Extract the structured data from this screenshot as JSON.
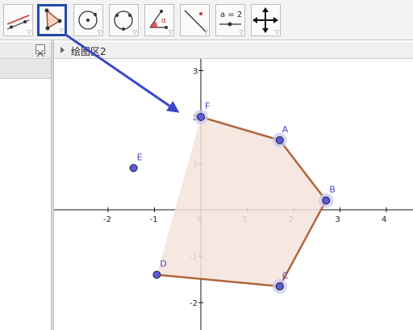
{
  "toolbar": {
    "tools": [
      {
        "name": "line-tool"
      },
      {
        "name": "polygon-tool",
        "selected": true
      },
      {
        "name": "circle-center-point-tool"
      },
      {
        "name": "circle-three-points-tool"
      },
      {
        "name": "angle-tool",
        "glyph": "α"
      },
      {
        "name": "perpendicular-tool"
      },
      {
        "name": "slider-tool",
        "label": "a = 2"
      },
      {
        "name": "move-view-tool"
      }
    ]
  },
  "graphics_view": {
    "title": "绘图区2",
    "x_ticks": [
      "-2",
      "-1",
      "0",
      "1",
      "2",
      "3",
      "4"
    ],
    "y_ticks": [
      "3",
      "2",
      "1",
      "-1",
      "-2"
    ]
  },
  "points": [
    {
      "label": "F",
      "x": 0,
      "y": 2
    },
    {
      "label": "A",
      "x": 1.7,
      "y": 1.5
    },
    {
      "label": "B",
      "x": 2.7,
      "y": 0.2
    },
    {
      "label": "C",
      "x": 1.7,
      "y": -1.65
    },
    {
      "label": "D",
      "x": -0.95,
      "y": -1.4
    },
    {
      "label": "E",
      "x": -1.45,
      "y": 0.9
    }
  ],
  "colors": {
    "polygon_stroke": "#b0663d",
    "polygon_fill": "#f4e4dc",
    "point_fill": "#5a5adc",
    "point_halo": "#c9c9f2",
    "arrow": "#3c47c8",
    "selected_border": "#1d4aa5"
  }
}
